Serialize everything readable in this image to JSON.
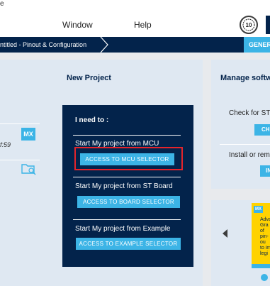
{
  "menubar": {
    "top_text": "e",
    "items": [
      "Window",
      "Help"
    ],
    "badge_icon": "10-anniversary-badge-icon"
  },
  "navbar": {
    "breadcrumb": "ntitled - Pinout & Configuration",
    "generate_label": "GENER"
  },
  "left_panel": {
    "title": "New Project",
    "date_fragment": "f:59",
    "mx_badge": "MX"
  },
  "new_project_box": {
    "heading": "I need to :",
    "sections": [
      {
        "label": "Start My project from MCU",
        "button": "ACCESS TO MCU SELECTOR"
      },
      {
        "label": "Start My project from ST Board",
        "button": "ACCESS TO BOARD SELECTOR"
      },
      {
        "label": "Start My project from Example",
        "button": "ACCESS TO EXAMPLE SELECTOR"
      }
    ]
  },
  "right_panel": {
    "title": "Manage softwa",
    "check_label": "Check for ST",
    "check_button": "CH",
    "install_label": "Install or rem",
    "install_button": "IN"
  },
  "carousel": {
    "badge": "MX",
    "text_lines": [
      "Adva",
      "Gra",
      "of",
      "pin-ou",
      "to im",
      "legi"
    ],
    "arrow": "left-arrow-icon"
  },
  "colors": {
    "navy": "#03234b",
    "accent": "#3cb4e6",
    "highlight": "#e5242b",
    "panel": "#dfe8f2"
  }
}
